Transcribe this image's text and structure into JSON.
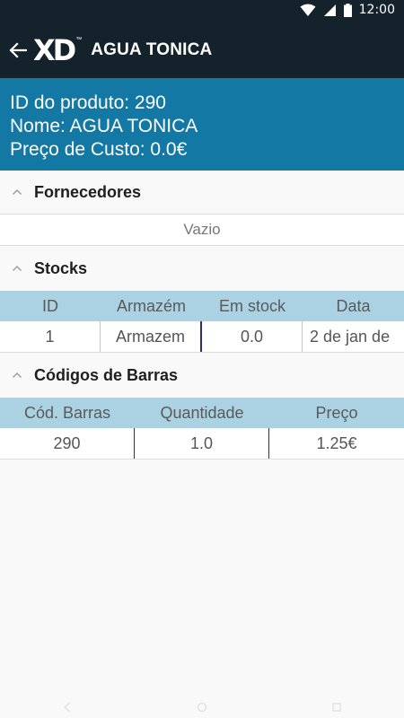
{
  "status_bar": {
    "time": "12:00"
  },
  "header": {
    "logo_text": "XD",
    "logo_tm": "™",
    "title": "AGUA TONICA"
  },
  "product": {
    "id_line": "ID do produto: 290",
    "name_line": "Nome: AGUA TONICA",
    "cost_line": "Preço de Custo: 0.0€"
  },
  "suppliers": {
    "title": "Fornecedores",
    "empty_text": "Vazio"
  },
  "stocks": {
    "title": "Stocks",
    "columns": [
      "ID",
      "Armazém",
      "Em stock",
      "Data"
    ],
    "rows": [
      {
        "id": "1",
        "warehouse": "Armazem",
        "in_stock": "0.0",
        "date": "2 de jan de"
      }
    ]
  },
  "barcodes": {
    "title": "Códigos de Barras",
    "columns": [
      "Cód. Barras",
      "Quantidade",
      "Preço"
    ],
    "rows": [
      {
        "barcode": "290",
        "quantity": "1.0",
        "price": "1.25€"
      }
    ]
  },
  "colors": {
    "app_bar": "#14222b",
    "info_panel": "#1478a4",
    "table_header": "#abd2e2",
    "background": "#f9f9f9"
  },
  "icons": [
    "wifi-icon",
    "signal-icon",
    "battery-icon",
    "back-arrow-icon",
    "chevron-up-icon",
    "nav-back-icon",
    "nav-home-icon",
    "nav-recents-icon"
  ]
}
